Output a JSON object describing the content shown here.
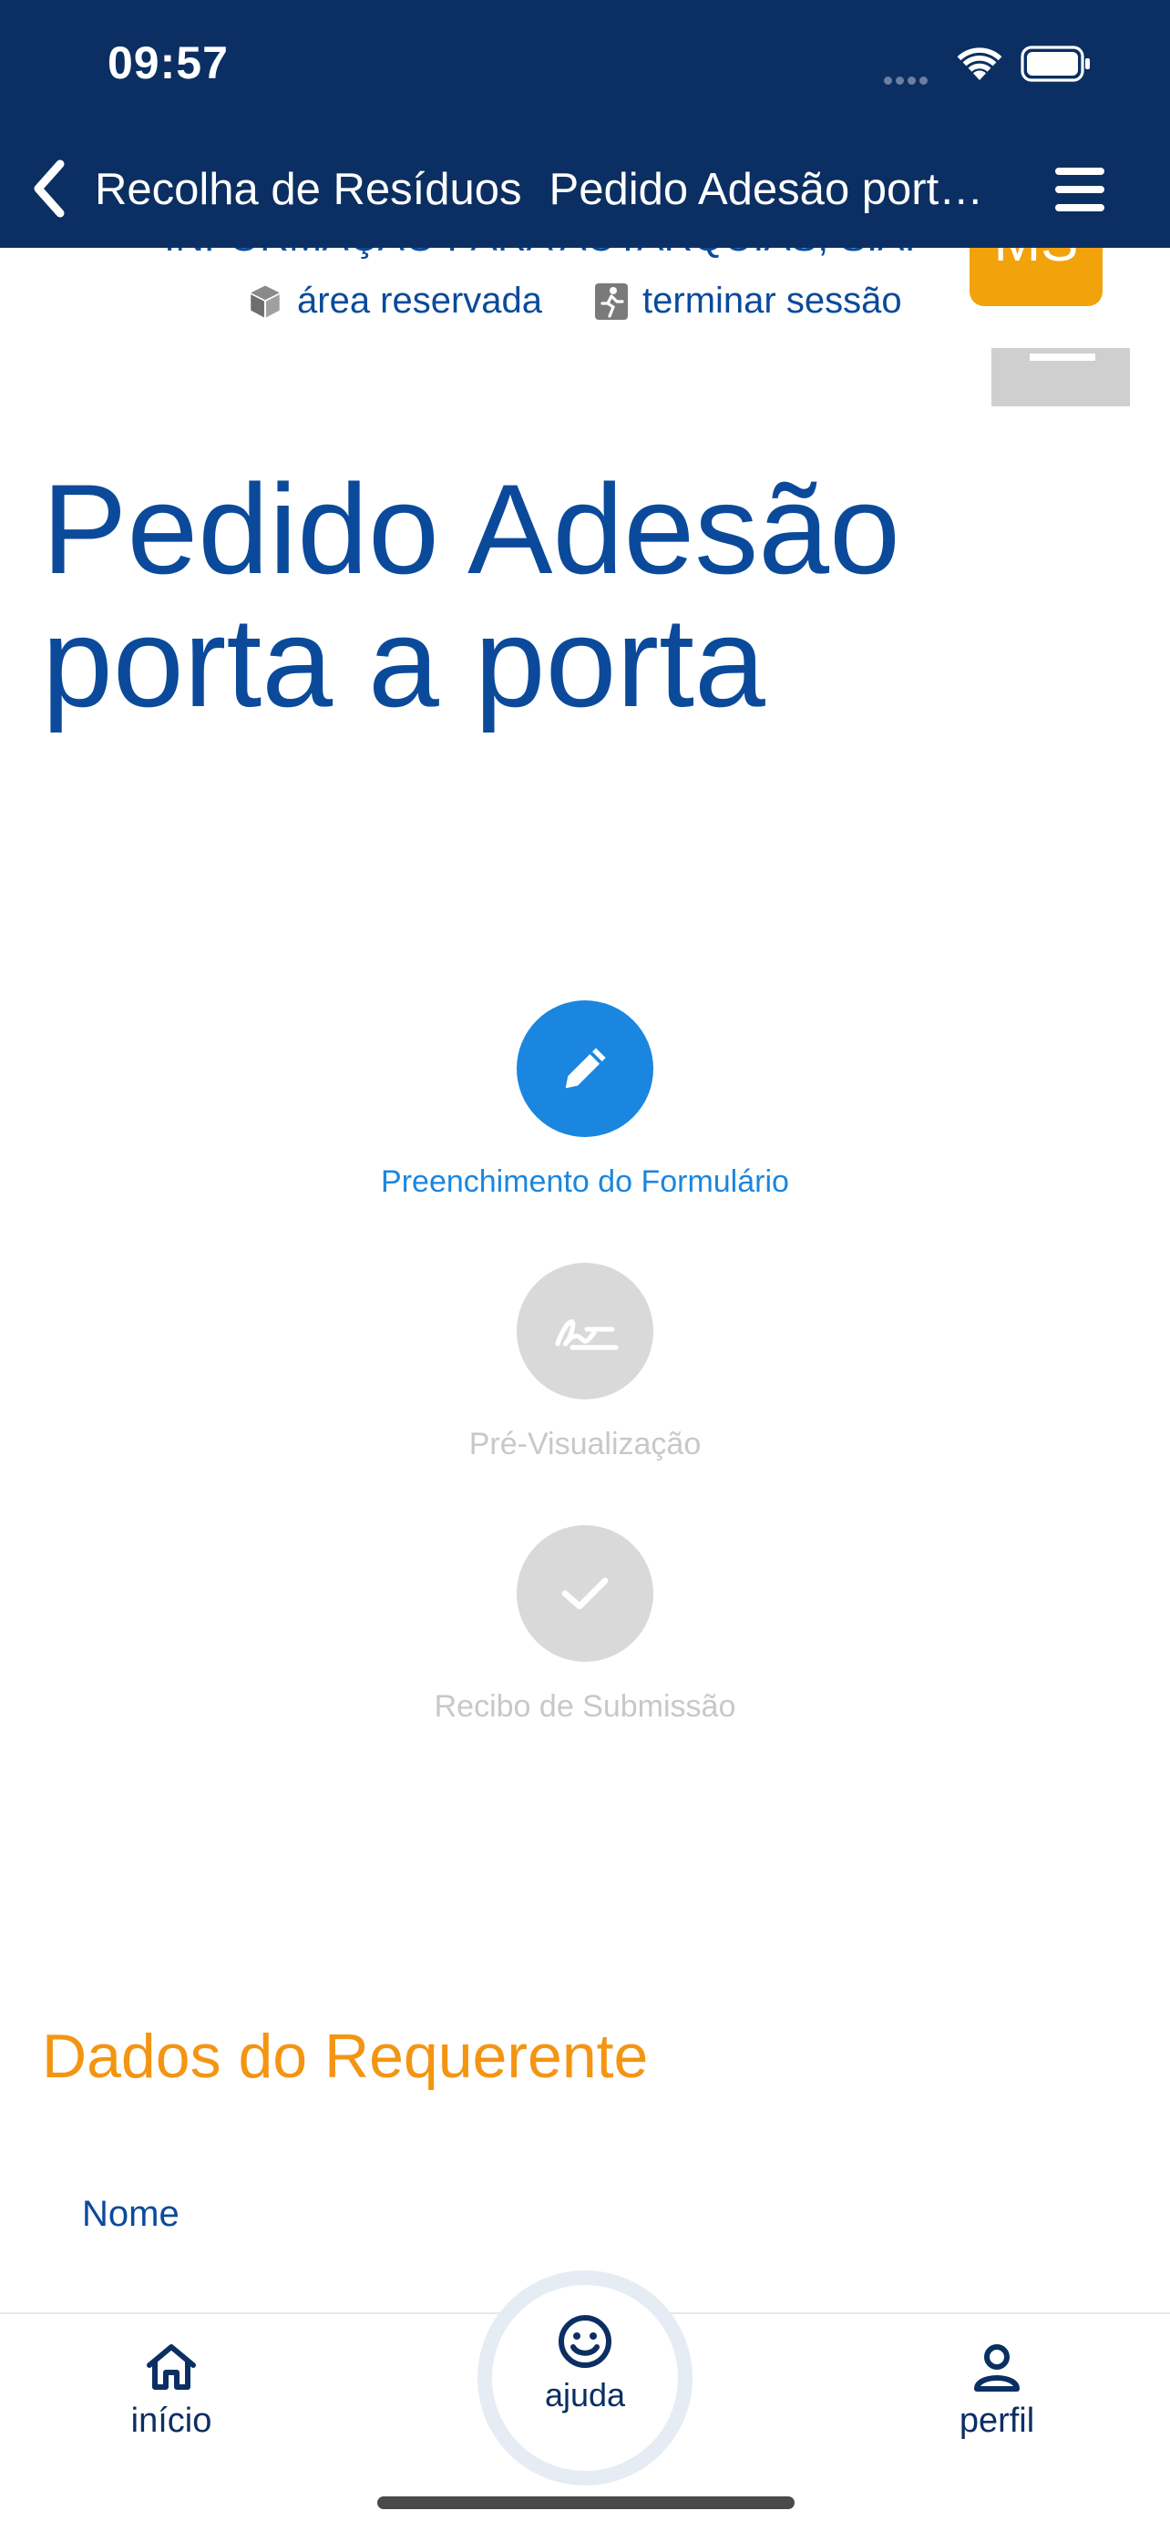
{
  "status_bar": {
    "time": "09:57"
  },
  "nav": {
    "breadcrumb": "Recolha de Resíduos",
    "title": "Pedido Adesão port…"
  },
  "header": {
    "org_name": "INFORMAÇÃO PARA AUTARQUIAS, S.A.",
    "reserved_area": "área reservada",
    "logout": "terminar sessão",
    "avatar_initials": "MS"
  },
  "page": {
    "title_line1": "Pedido Adesão",
    "title_line2": "porta a porta"
  },
  "steps": [
    {
      "label": "Preenchimento do Formulário",
      "state": "active",
      "icon": "pencil-icon"
    },
    {
      "label": "Pré-Visualização",
      "state": "inactive",
      "icon": "signature-icon"
    },
    {
      "label": "Recibo de Submissão",
      "state": "inactive",
      "icon": "check-icon"
    }
  ],
  "section": {
    "title": "Dados do Requerente",
    "field_name_label": "Nome"
  },
  "tabbar": {
    "home_label": "início",
    "help_label": "ajuda",
    "profile_label": "perfil"
  },
  "colors": {
    "nav_background": "#0b2f62",
    "primary_blue": "#0b4a9b",
    "step_active": "#1a86e0",
    "step_inactive": "#d9d9d9",
    "section_orange": "#f39512",
    "avatar_orange": "#f2a30b"
  }
}
